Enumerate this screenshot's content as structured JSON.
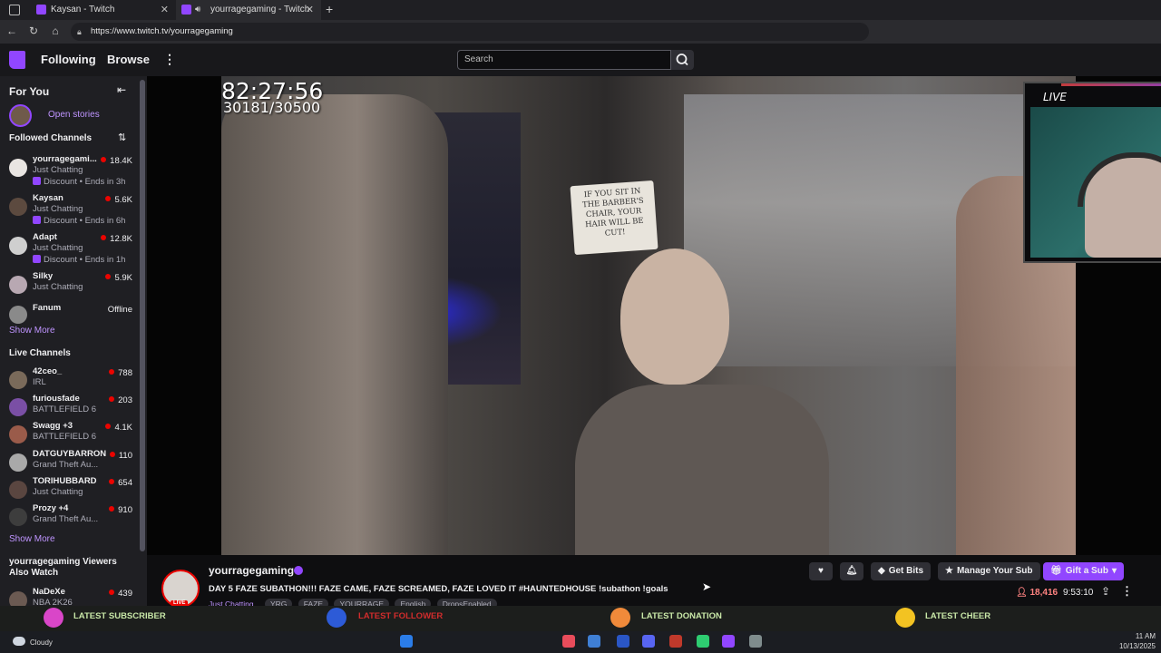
{
  "browser": {
    "tabs": [
      {
        "title": "Kaysan - Twitch"
      },
      {
        "title": "yourragegaming - Twitch"
      }
    ],
    "url": "https://www.twitch.tv/yourragegaming"
  },
  "nav": {
    "following": "Following",
    "browse": "Browse",
    "search_placeholder": "Search"
  },
  "sidebar": {
    "for_you": "For You",
    "open_stories": "Open stories",
    "followed_header": "Followed Channels",
    "followed": [
      {
        "name": "yourragegami...",
        "game": "Just Chatting",
        "viewers": "18.4K",
        "discount": "Discount • Ends in 3h"
      },
      {
        "name": "Kaysan",
        "game": "Just Chatting",
        "viewers": "5.6K",
        "discount": "Discount • Ends in 6h"
      },
      {
        "name": "Adapt",
        "game": "Just Chatting",
        "viewers": "12.8K",
        "discount": "Discount • Ends in 1h"
      },
      {
        "name": "Silky",
        "game": "Just Chatting",
        "viewers": "5.9K"
      },
      {
        "name": "Fanum",
        "status": "Offline"
      }
    ],
    "show_more_1": "Show More",
    "live_header": "Live Channels",
    "live": [
      {
        "name": "42ceo_",
        "game": "IRL",
        "viewers": "788"
      },
      {
        "name": "furiousfade",
        "game": "BATTLEFIELD 6",
        "viewers": "203"
      },
      {
        "name": "Swagg +3",
        "game": "BATTLEFIELD 6",
        "viewers": "4.1K"
      },
      {
        "name": "DATGUYBARRON",
        "game": "Grand Theft Au...",
        "viewers": "110"
      },
      {
        "name": "TORIHUBBARD",
        "game": "Just Chatting",
        "viewers": "654"
      },
      {
        "name": "Prozy +4",
        "game": "Grand Theft Au...",
        "viewers": "910"
      }
    ],
    "show_more_2": "Show More",
    "also_watch_header": "yourragegaming Viewers Also Watch",
    "also_watch": [
      {
        "name": "NaDeXe",
        "game": "NBA 2K26",
        "viewers": "439"
      }
    ]
  },
  "video": {
    "timer": "82:27:56",
    "subs": "30181/30500",
    "sign_text": "IF YOU SIT IN THE BARBER'S CHAIR, YOUR HAIR WILL BE CUT!",
    "cam_live": "LIVE"
  },
  "stream": {
    "name": "yourragegaming",
    "title": "DAY 5 FAZE SUBATHON!!! FAZE CAME, FAZE SCREAMED, FAZE LOVED IT #HAUNTEDHOUSE !subathon !goals",
    "tags": [
      "Just Chatting",
      "YRG",
      "FAZE",
      "YOURRAGE",
      "English",
      "DropsEnabled"
    ],
    "live_badge": "LIVE",
    "get_bits": "Get Bits",
    "manage_sub": "Manage Your Sub",
    "gift_sub": "Gift a Sub",
    "viewers": "18,416",
    "uptime": "9:53:10"
  },
  "alerts": {
    "subscriber": "LATEST SUBSCRIBER",
    "follower": "LATEST FOLLOWER",
    "donation": "LATEST DONATION",
    "cheer": "LATEST CHEER"
  },
  "taskbar": {
    "weather": "Cloudy",
    "time": "11 AM",
    "date": "10/13/2025"
  },
  "colors": {
    "accent": "#9146ff",
    "live_red": "#eb0400",
    "alert_text": "#c9e8a8"
  }
}
